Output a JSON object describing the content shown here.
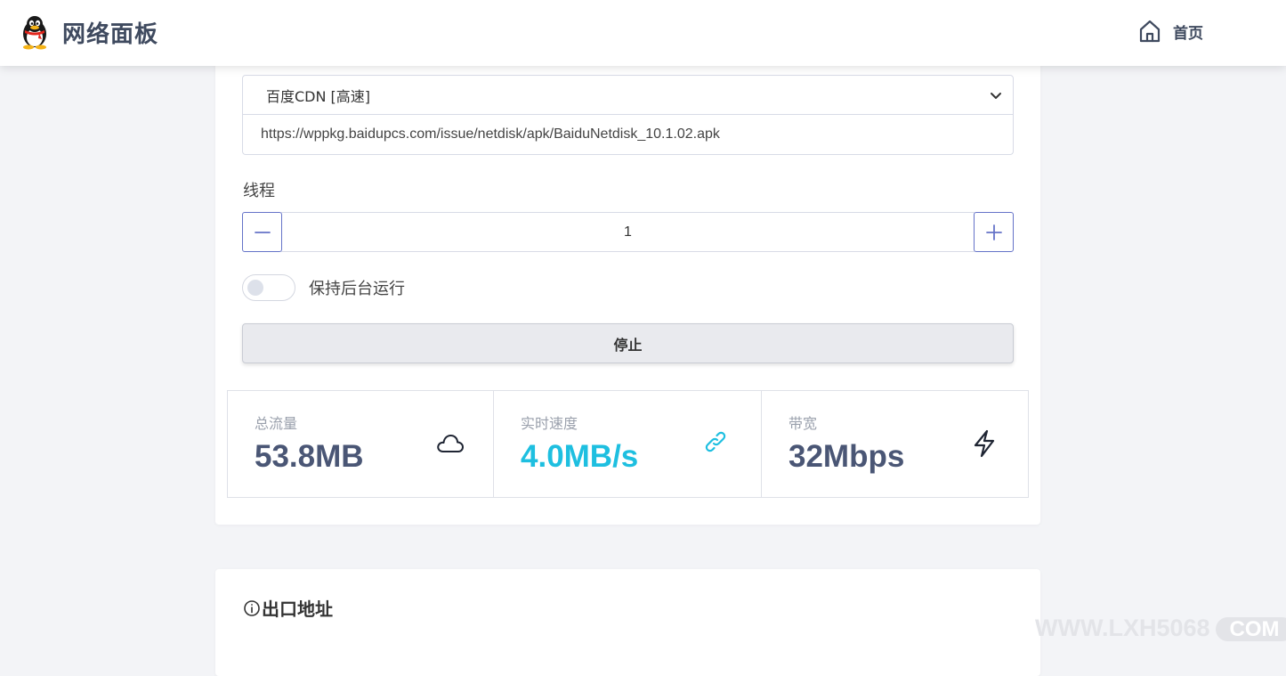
{
  "app": {
    "title": "网络面板",
    "nav_home_label": "首页"
  },
  "form": {
    "source_select": {
      "selected": "百度CDN [高速]"
    },
    "url_value": "https://wppkg.baidupcs.com/issue/netdisk/apk/BaiduNetdisk_10.1.02.apk",
    "threads_label": "线程",
    "threads_value": "1",
    "background_toggle": {
      "label": "保持后台运行",
      "on": false
    },
    "stop_button_label": "停止"
  },
  "stats": [
    {
      "label": "总流量",
      "value": "53.8MB",
      "icon": "cloud-icon",
      "color": "#4a5675"
    },
    {
      "label": "实时速度",
      "value": "4.0MB/s",
      "icon": "link-icon",
      "color": "#1ebfe0"
    },
    {
      "label": "带宽",
      "value": "32Mbps",
      "icon": "bolt-icon",
      "color": "#4a5675"
    }
  ],
  "exit_section": {
    "title": "出口地址",
    "icon": "info-icon"
  },
  "watermark": {
    "text": "WWW.LXH5068",
    "suffix": "COM"
  },
  "colors": {
    "accent": "#6573c8",
    "speed": "#1ebfe0",
    "text_dark": "#4a5675",
    "background": "#f3f4f7"
  }
}
